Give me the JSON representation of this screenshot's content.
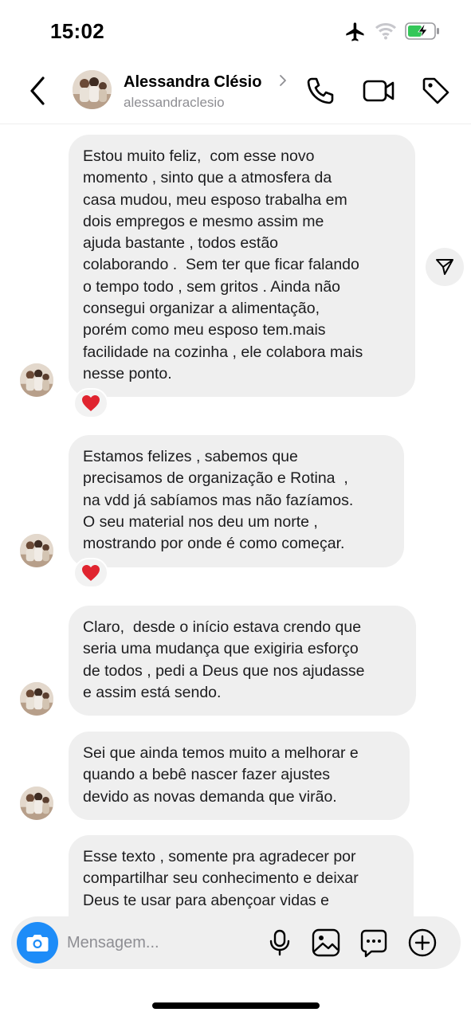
{
  "status_bar": {
    "time": "15:02",
    "icons": [
      "airplane-icon",
      "wifi-icon",
      "battery-charging-icon"
    ],
    "battery_color": "#34c759"
  },
  "header": {
    "contact_name": "Alessandra Clésio",
    "contact_handle": "alessandraclesio",
    "icons": [
      "back-chevron-icon",
      "chevron-right-icon",
      "phone-icon",
      "video-camera-icon",
      "tag-icon"
    ]
  },
  "messages": [
    {
      "text": "Estou muito feliz,  com esse novo\nmomento , sinto que a atmosfera da\ncasa mudou, meu esposo trabalha em\ndois empregos e mesmo assim me\najuda bastante , todos estão\ncolaborando .  Sem ter que ficar falando\no tempo todo , sem gritos . Ainda não\nconsegui organizar a alimentação,\nporém como meu esposo tem.mais\nfacilidade na cozinha , ele colabora mais\nnesse ponto.",
      "reaction": "heart"
    },
    {
      "text": "Estamos felizes , sabemos que\nprecisamos de organização e Rotina  ,\nna vdd já sabíamos mas não fazíamos.\nO seu material nos deu um norte ,\nmostrando por onde é como começar.",
      "reaction": "heart"
    },
    {
      "text": "Claro,  desde o início estava crendo que\nseria uma mudança que exigiria esforço\nde todos , pedi a Deus que nos ajudasse\ne assim está sendo.",
      "reaction": ""
    },
    {
      "text": "Sei que ainda temos muito a melhorar e\nquando a bebê nascer fazer ajustes\ndevido as novas demanda que virão.",
      "reaction": ""
    },
    {
      "text": "Esse texto , somente pra agradecer por\ncompartilhar seu conhecimento e deixar\nDeus te usar para abençoar vidas e",
      "reaction": ""
    }
  ],
  "share_button_icon": "send-icon",
  "composer": {
    "placeholder": "Mensagem...",
    "value": "",
    "accent_color": "#1d8cf8",
    "icons": [
      "camera-icon",
      "microphone-icon",
      "gallery-icon",
      "sticker-icon",
      "plus-circle-icon"
    ]
  }
}
